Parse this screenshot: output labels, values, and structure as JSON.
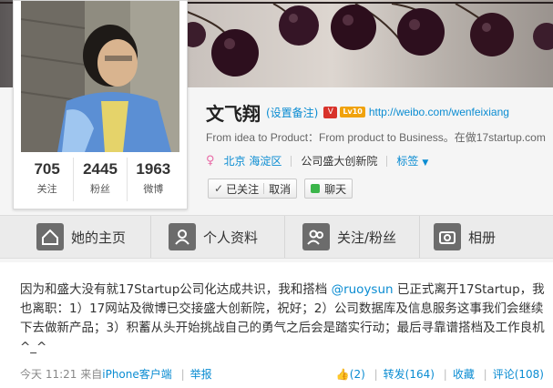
{
  "profile": {
    "name": "文飞翔",
    "remark_link": "(设置备注)",
    "vip_badge": "V",
    "level_badge": "Lv10",
    "weibo_url": "http://weibo.com/wenfeixiang",
    "description": "From idea to Product：From product to Business。在做17startup.com",
    "location": "北京 海淀区",
    "company": "公司盛大创新院",
    "tags_label": "标签"
  },
  "stats": [
    {
      "num": "705",
      "label": "关注"
    },
    {
      "num": "2445",
      "label": "粉丝"
    },
    {
      "num": "1963",
      "label": "微博"
    }
  ],
  "buttons": {
    "followed": "已关注",
    "cancel": "取消",
    "chat": "聊天"
  },
  "tabs": [
    {
      "label": "她的主页",
      "icon": "home-icon"
    },
    {
      "label": "个人资料",
      "icon": "person-icon"
    },
    {
      "label": "关注/粉丝",
      "icon": "people-icon"
    },
    {
      "label": "相册",
      "icon": "camera-icon"
    }
  ],
  "post": {
    "text_a": "因为和盛大没有就17Startup公司化达成共识，我和搭档 ",
    "mention": "@ruoysun",
    "text_b": " 已正式离开17Startup，我也离职：1）17网站及微博已交接盛大创新院，祝好；2）公司数据库及信息服务这事我们会继续下去做新产品；3）积蓄从头开始挑战自己的勇气之后会是踏实行动；最后寻靠谱搭档及工作良机^_^",
    "time": "今天 11:21",
    "source_prefix": "来自",
    "source": "iPhone客户端",
    "report": "举报",
    "likes": "(2)",
    "repost": "转发(164)",
    "favorite": "收藏",
    "comment": "评论(108)"
  },
  "colors": {
    "link": "#0a8cd2",
    "tab_icon_bg": "#6c6c6c",
    "chat_green": "#3bb54a"
  }
}
